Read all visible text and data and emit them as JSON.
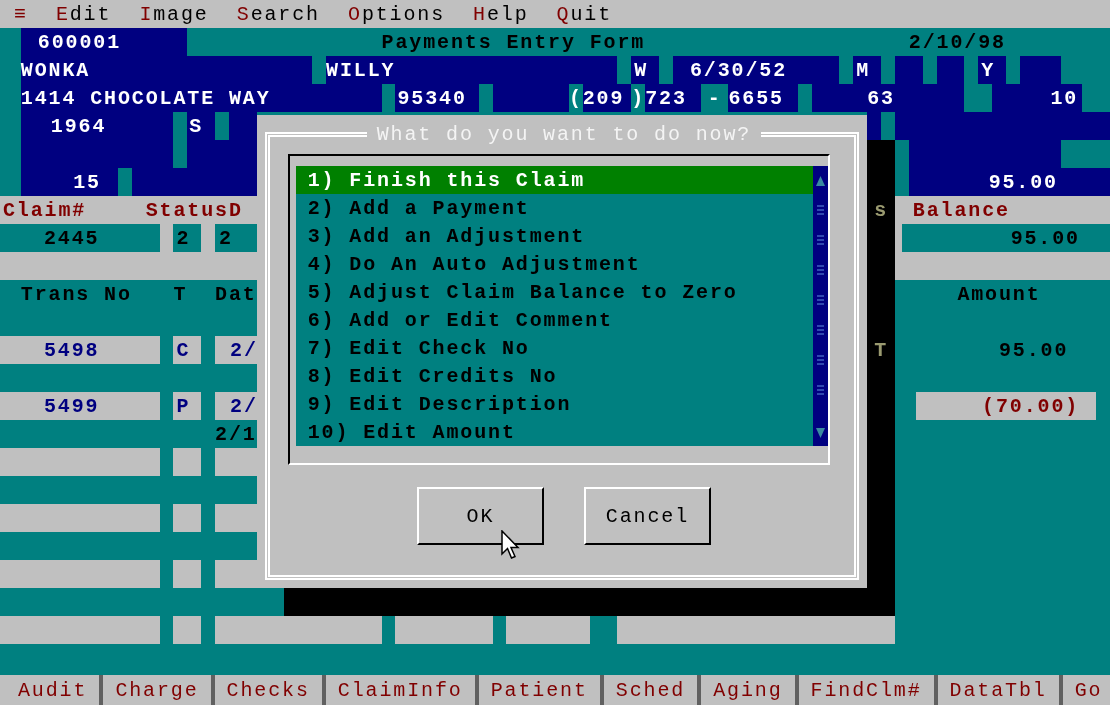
{
  "menu": [
    {
      "label": "≡"
    },
    {
      "label": "Edit"
    },
    {
      "label": "Image"
    },
    {
      "label": "Search"
    },
    {
      "label": "Options"
    },
    {
      "label": "Help"
    },
    {
      "label": "Quit"
    }
  ],
  "header": {
    "account": "600001",
    "title": "Payments Entry Form",
    "date": "2/10/98",
    "last_name": "WONKA",
    "first_name": "WILLY",
    "middle_initial": "W",
    "birth_date": "6/30/52",
    "unlabeled_1": "M",
    "unlabeled_2": "Y",
    "address": "1414 CHOCOLATE WAY",
    "zip": "95340",
    "phone_open": "(",
    "phone_area": "209",
    "phone_close": ")",
    "phone_prefix": "723",
    "phone_dash": "-",
    "phone_line": "6655",
    "unlabeled_3": "63",
    "unlabeled_4": "10",
    "unlabeled_5": "1964",
    "unlabeled_6": "S",
    "unlabeled_7": "15",
    "unlabeled_8": "95.00"
  },
  "claim": {
    "labels": [
      "Claim#",
      "Status",
      "D"
    ],
    "claim_no": "2445",
    "status": "2",
    "column_3": "2",
    "balance_label": "Balance",
    "balance": "95.00"
  },
  "shadow_text": [
    "s",
    "T"
  ],
  "transactions": {
    "columns": [
      "Trans No",
      "T",
      "Dat",
      "Amount"
    ],
    "rows": [
      {
        "trans_no": "5498",
        "type": "C",
        "date": "2/",
        "amount": "95.00",
        "selected": false
      },
      {
        "trans_no": "5499",
        "type": "P",
        "date": "2/",
        "amount": "(70.00)",
        "selected": true
      }
    ],
    "extra_date": "2/1"
  },
  "dialog": {
    "title": "What do you want to do now?",
    "options": [
      {
        "label": "1) Finish this Claim",
        "selected": true
      },
      {
        "label": "2) Add a Payment",
        "selected": false
      },
      {
        "label": "3) Add an Adjustment",
        "selected": false
      },
      {
        "label": "4) Do An Auto Adjustment",
        "selected": false
      },
      {
        "label": "5) Adjust Claim Balance to Zero",
        "selected": false
      },
      {
        "label": "6) Add or Edit Comment",
        "selected": false
      },
      {
        "label": "7) Edit Check No",
        "selected": false
      },
      {
        "label": "8) Edit Credits No",
        "selected": false
      },
      {
        "label": "9) Edit Description",
        "selected": false
      },
      {
        "label": "10) Edit Amount",
        "selected": false
      }
    ],
    "buttons": [
      "OK",
      "Cancel"
    ]
  },
  "function_keys": [
    "Audit",
    "Charge",
    "Checks",
    "ClaimInfo",
    "Patient",
    "Sched",
    "Aging",
    "FindClm#",
    "DataTbl",
    "Go"
  ]
}
